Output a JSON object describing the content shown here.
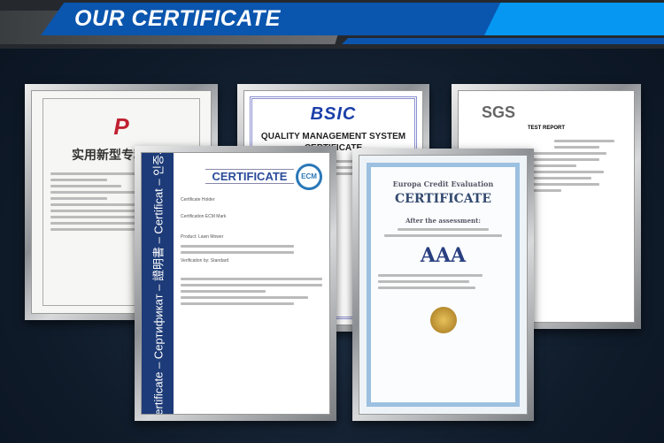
{
  "header": {
    "title": "OUR CERTIFICATE"
  },
  "certificates": {
    "patent": {
      "title": "实用新型专利证书",
      "logo": "P"
    },
    "bsic": {
      "logo": "BSIC",
      "title": "QUALITY MANAGEMENT SYSTEM",
      "subtitle": "CERTIFICATE"
    },
    "sgs": {
      "logo": "SGS",
      "title": "TEST REPORT"
    },
    "ce": {
      "title": "CERTIFICATE",
      "side_text": "Certificate – Сертификат – 證明書 – Certificat – 인증서",
      "badge": "ECM",
      "product_label": "Product:",
      "product": "Lawn Mower",
      "holder_label": "Certificate Holder",
      "mark_label": "Certification ECM Mark",
      "verification_label": "Verification by:",
      "standard": "Standard"
    },
    "europa": {
      "org": "Europa Credit Evaluation",
      "title": "CERTIFICATE",
      "after": "After the assessment:",
      "rating": "AAA"
    }
  },
  "colors": {
    "accent": "#0a55ae",
    "accent_light": "#0697f2",
    "ce_side": "#1d3b78"
  }
}
